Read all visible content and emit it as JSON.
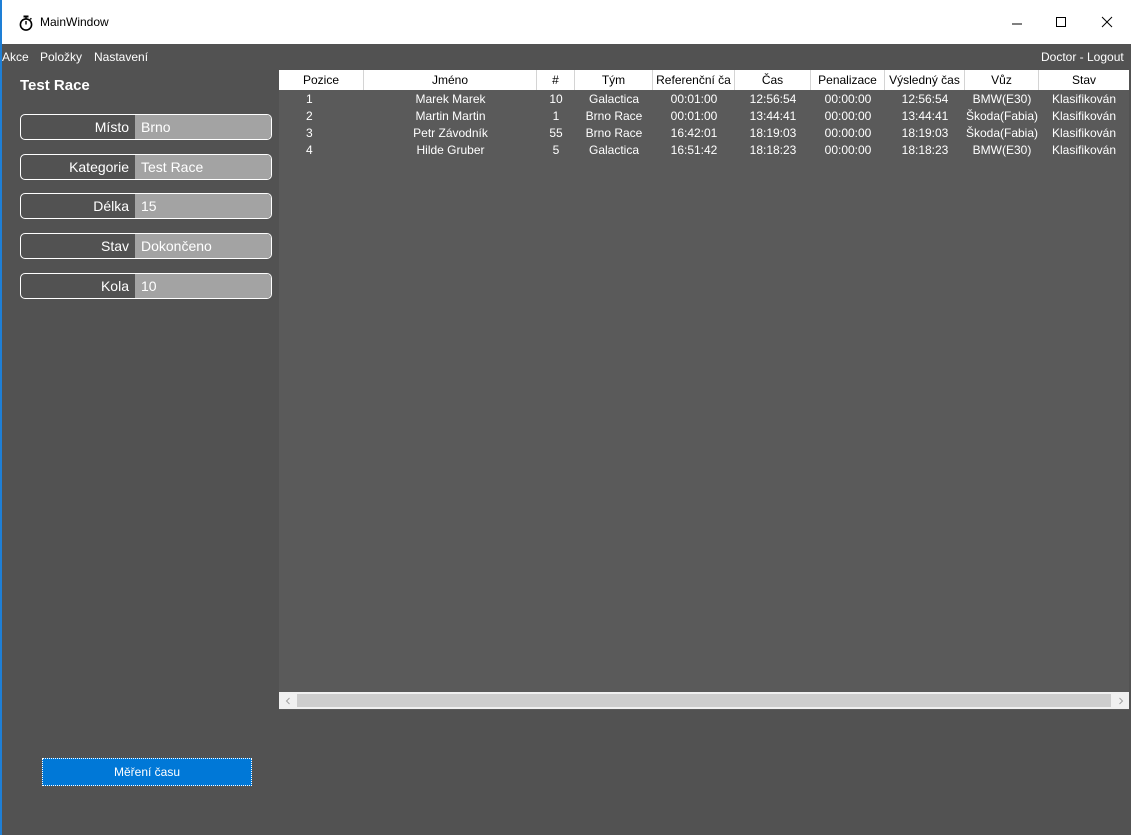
{
  "window": {
    "title": "MainWindow"
  },
  "menu": {
    "items": [
      "Akce",
      "Položky",
      "Nastavení"
    ],
    "user": "Doctor - Logout"
  },
  "race": {
    "title": "Test Race"
  },
  "info": [
    {
      "label": "Místo",
      "value": "Brno"
    },
    {
      "label": "Kategorie",
      "value": "Test Race"
    },
    {
      "label": "Délka",
      "value": "15"
    },
    {
      "label": "Stav",
      "value": "Dokončeno"
    },
    {
      "label": "Kola",
      "value": "10"
    }
  ],
  "table": {
    "headers": [
      "Pozice",
      "Jméno",
      "#",
      "Tým",
      "Referenční ča",
      "Čas",
      "Penalizace",
      "Výsledný čas",
      "Vůz",
      "Stav"
    ],
    "rows": [
      [
        "1",
        "Marek Marek",
        "10",
        "Galactica",
        "00:01:00",
        "12:56:54",
        "00:00:00",
        "12:56:54",
        "BMW(E30)",
        "Klasifikován"
      ],
      [
        "2",
        "Martin Martin",
        "1",
        "Brno Race",
        "00:01:00",
        "13:44:41",
        "00:00:00",
        "13:44:41",
        "Škoda(Fabia)",
        "Klasifikován"
      ],
      [
        "3",
        "Petr Závodník",
        "55",
        "Brno Race",
        "16:42:01",
        "18:19:03",
        "00:00:00",
        "18:19:03",
        "Škoda(Fabia)",
        "Klasifikován"
      ],
      [
        "4",
        "Hilde Gruber",
        "5",
        "Galactica",
        "16:51:42",
        "18:18:23",
        "00:00:00",
        "18:18:23",
        "BMW(E30)",
        "Klasifikován"
      ]
    ]
  },
  "actions": {
    "measure_label": "Měření času"
  },
  "colors": {
    "accent": "#0078d7",
    "background": "#525252",
    "value_box": "#a3a3a3"
  }
}
